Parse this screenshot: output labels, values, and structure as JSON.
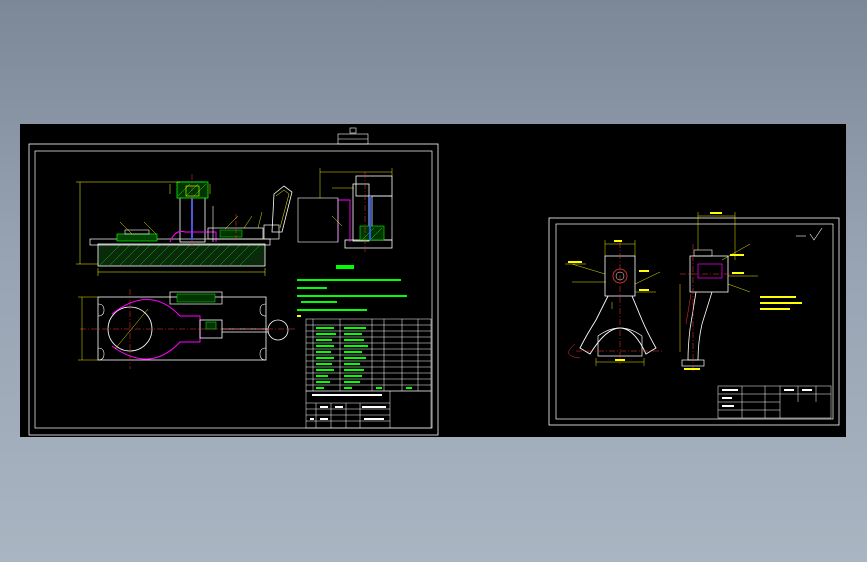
{
  "colors": {
    "frame": "#ffffff",
    "outline": "#ffffff",
    "dimension": "#ffff00",
    "hatch": "#00ff00",
    "centerline": "#ff3030",
    "clamp": "#2a5cff",
    "fixture": "#ff00ff",
    "note": "#00ff00",
    "note_alt": "#ffff00",
    "lime": "#00ff00",
    "cyan": "#00ffff"
  },
  "icons": {
    "scale_mark": "roughness-symbol-icon",
    "datum_mark": "datum-symbol-icon"
  }
}
